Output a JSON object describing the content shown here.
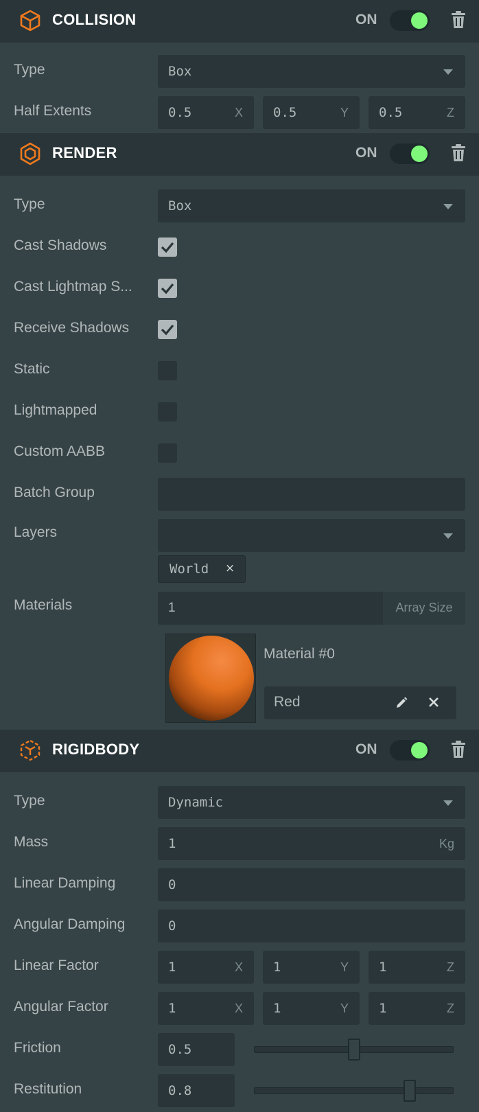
{
  "collision": {
    "title": "COLLISION",
    "on_label": "ON",
    "enabled": true,
    "type_label": "Type",
    "type_value": "Box",
    "half_extents_label": "Half Extents",
    "half_extents": [
      {
        "axis": "X",
        "value": "0.5"
      },
      {
        "axis": "Y",
        "value": "0.5"
      },
      {
        "axis": "Z",
        "value": "0.5"
      }
    ]
  },
  "render": {
    "title": "RENDER",
    "on_label": "ON",
    "enabled": true,
    "type_label": "Type",
    "type_value": "Box",
    "checkboxes": [
      {
        "label": "Cast Shadows",
        "checked": true
      },
      {
        "label": "Cast Lightmap S...",
        "checked": true
      },
      {
        "label": "Receive Shadows",
        "checked": true
      },
      {
        "label": "Static",
        "checked": false
      },
      {
        "label": "Lightmapped",
        "checked": false
      },
      {
        "label": "Custom AABB",
        "checked": false
      }
    ],
    "batch_group_label": "Batch Group",
    "batch_group_value": "",
    "layers_label": "Layers",
    "layers_value": "",
    "layer_tags": [
      {
        "name": "World",
        "remove": "×"
      }
    ],
    "materials_label": "Materials",
    "materials_count": "1",
    "array_size_label": "Array Size",
    "material_slot": {
      "name": "Material #0",
      "value": "Red",
      "remove": "×"
    }
  },
  "rigidbody": {
    "title": "RIGIDBODY",
    "on_label": "ON",
    "enabled": true,
    "type_label": "Type",
    "type_value": "Dynamic",
    "mass_label": "Mass",
    "mass_value": "1",
    "mass_unit": "Kg",
    "linear_damping_label": "Linear Damping",
    "linear_damping_value": "0",
    "angular_damping_label": "Angular Damping",
    "angular_damping_value": "0",
    "linear_factor_label": "Linear Factor",
    "linear_factor": [
      {
        "axis": "X",
        "value": "1"
      },
      {
        "axis": "Y",
        "value": "1"
      },
      {
        "axis": "Z",
        "value": "1"
      }
    ],
    "angular_factor_label": "Angular Factor",
    "angular_factor": [
      {
        "axis": "X",
        "value": "1"
      },
      {
        "axis": "Y",
        "value": "1"
      },
      {
        "axis": "Z",
        "value": "1"
      }
    ],
    "friction_label": "Friction",
    "friction_value": "0.5",
    "friction_slider": 0.5,
    "restitution_label": "Restitution",
    "restitution_value": "0.8",
    "restitution_slider": 0.8
  },
  "colors": {
    "accent": "#f07a1e",
    "toggle_on": "#7ef77a",
    "header_bg": "#293538",
    "panel_bg": "#364346"
  },
  "icons": {
    "collision": "cube-outline-icon",
    "render": "hexagon-icon",
    "rigidbody": "cube-nodes-icon",
    "delete": "trash-icon",
    "edit": "pencil-icon",
    "remove": "close-icon",
    "dropdown": "chevron-down-icon",
    "checked": "checkmark-icon"
  }
}
